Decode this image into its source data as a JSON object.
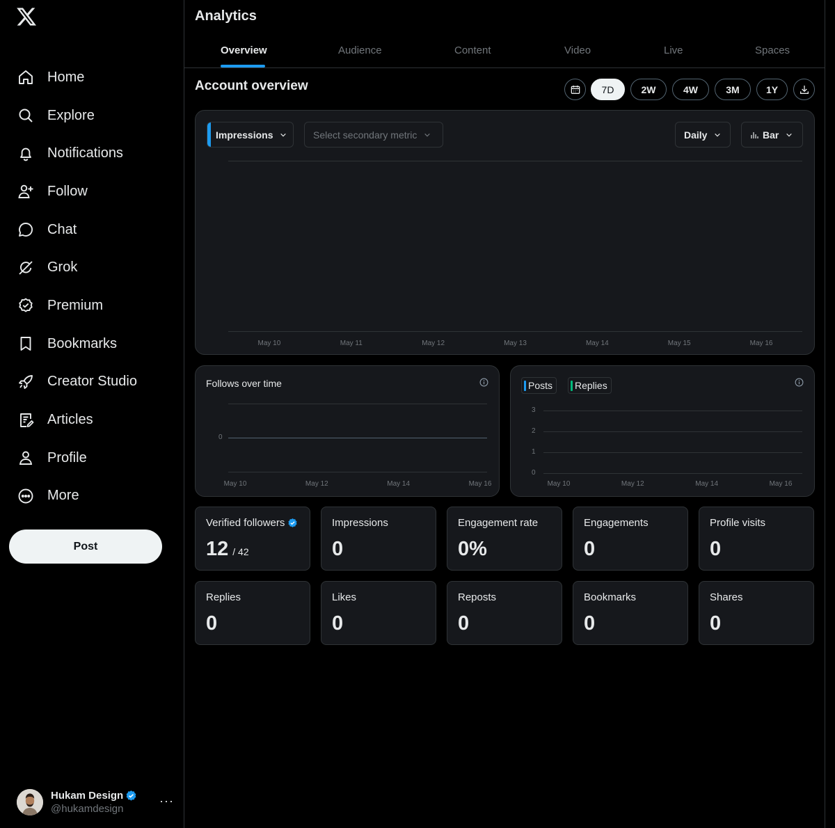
{
  "sidebar": {
    "logo_icon": "x-logo-icon",
    "items": [
      {
        "label": "Home",
        "icon": "home-icon"
      },
      {
        "label": "Explore",
        "icon": "search-icon"
      },
      {
        "label": "Notifications",
        "icon": "bell-icon"
      },
      {
        "label": "Follow",
        "icon": "person-add-icon"
      },
      {
        "label": "Chat",
        "icon": "chat-icon"
      },
      {
        "label": "Grok",
        "icon": "grok-icon"
      },
      {
        "label": "Premium",
        "icon": "premium-badge-icon"
      },
      {
        "label": "Bookmarks",
        "icon": "bookmark-icon"
      },
      {
        "label": "Creator Studio",
        "icon": "rocket-icon"
      },
      {
        "label": "Articles",
        "icon": "article-icon"
      },
      {
        "label": "Profile",
        "icon": "person-icon"
      },
      {
        "label": "More",
        "icon": "more-circle-icon"
      }
    ],
    "post_label": "Post",
    "account": {
      "name": "Hukam Design",
      "handle": "@hukamdesign",
      "more": "···"
    }
  },
  "header": {
    "title": "Analytics"
  },
  "tabs": [
    {
      "label": "Overview",
      "active": true
    },
    {
      "label": "Audience"
    },
    {
      "label": "Content"
    },
    {
      "label": "Video"
    },
    {
      "label": "Live"
    },
    {
      "label": "Spaces"
    }
  ],
  "overview": {
    "title": "Account overview",
    "ranges": [
      "7D",
      "2W",
      "4W",
      "3M",
      "1Y"
    ],
    "active_range": "7D"
  },
  "main_chart": {
    "primary_metric": "Impressions",
    "secondary_placeholder": "Select secondary metric",
    "interval": "Daily",
    "chart_type_label": "Bar"
  },
  "colors": {
    "accent": "#1d9bf0",
    "posts": "#1d9bf0",
    "replies": "#00ba7c",
    "card_bg": "#16181c",
    "border": "#2f3336"
  },
  "chart_data": [
    {
      "type": "bar",
      "categories": [
        "May 10",
        "May 11",
        "May 12",
        "May 13",
        "May 14",
        "May 15",
        "May 16"
      ],
      "series": [
        {
          "name": "Impressions",
          "values": [
            0,
            0,
            0,
            0,
            0,
            0,
            0
          ]
        }
      ]
    },
    {
      "type": "line",
      "title": "Follows over time",
      "categories": [
        "May 10",
        "May 12",
        "May 14",
        "May 16"
      ],
      "yticks": [
        "0"
      ],
      "series": [
        {
          "values": [
            0,
            0,
            0,
            0
          ]
        }
      ]
    },
    {
      "type": "bar",
      "categories": [
        "May 10",
        "May 12",
        "May 14",
        "May 16"
      ],
      "yticks": [
        "3",
        "2",
        "1",
        "0"
      ],
      "ylim": [
        0,
        3
      ],
      "series": [
        {
          "name": "Posts",
          "values": [
            0,
            0,
            0,
            0
          ]
        },
        {
          "name": "Replies",
          "values": [
            0,
            0,
            0,
            0
          ]
        }
      ]
    }
  ],
  "stats": [
    {
      "label": "Verified followers",
      "value": "12",
      "sub": "/ 42",
      "verified": true
    },
    {
      "label": "Impressions",
      "value": "0"
    },
    {
      "label": "Engagement rate",
      "value": "0%"
    },
    {
      "label": "Engagements",
      "value": "0"
    },
    {
      "label": "Profile visits",
      "value": "0"
    },
    {
      "label": "Replies",
      "value": "0"
    },
    {
      "label": "Likes",
      "value": "0"
    },
    {
      "label": "Reposts",
      "value": "0"
    },
    {
      "label": "Bookmarks",
      "value": "0"
    },
    {
      "label": "Shares",
      "value": "0"
    }
  ]
}
